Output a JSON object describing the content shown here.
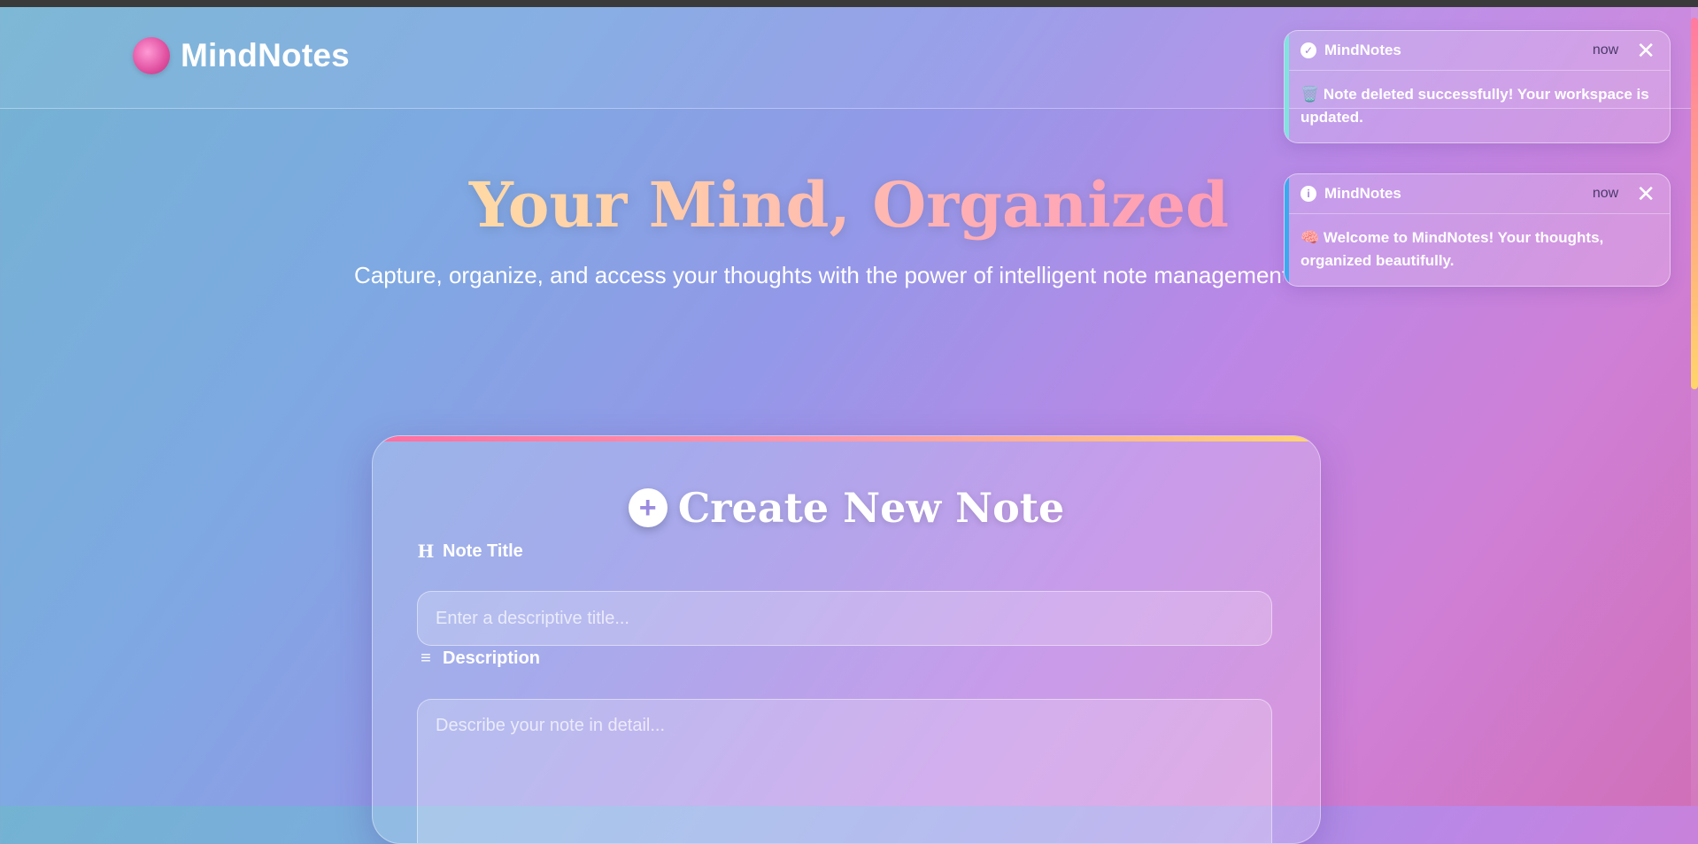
{
  "header": {
    "brand_icon": "brain-icon",
    "brand_name": "MindNotes"
  },
  "hero": {
    "title": "Your Mind, Organized",
    "subtitle": "Capture, organize, and access your thoughts with the power of intelligent note management."
  },
  "create_card": {
    "heading": "Create New Note",
    "plus_glyph": "+",
    "title_label": "Note Title",
    "title_icon": "H",
    "title_placeholder": "Enter a descriptive title...",
    "description_label": "Description",
    "description_icon": "≡",
    "description_placeholder": "Describe your note in detail..."
  },
  "toasts": [
    {
      "type": "success",
      "icon": "check-icon",
      "app": "MindNotes",
      "time": "now",
      "message": "🗑️ Note deleted successfully! Your workspace is updated.",
      "accent": "#7fe3e0"
    },
    {
      "type": "info",
      "icon": "info-icon",
      "app": "MindNotes",
      "time": "now",
      "message": "🧠 Welcome to MindNotes! Your thoughts, organized beautifully.",
      "accent": "#3aaaf0"
    }
  ],
  "colors": {
    "card_accent_start": "#ff6ea0",
    "card_accent_end": "#ffd66e"
  }
}
